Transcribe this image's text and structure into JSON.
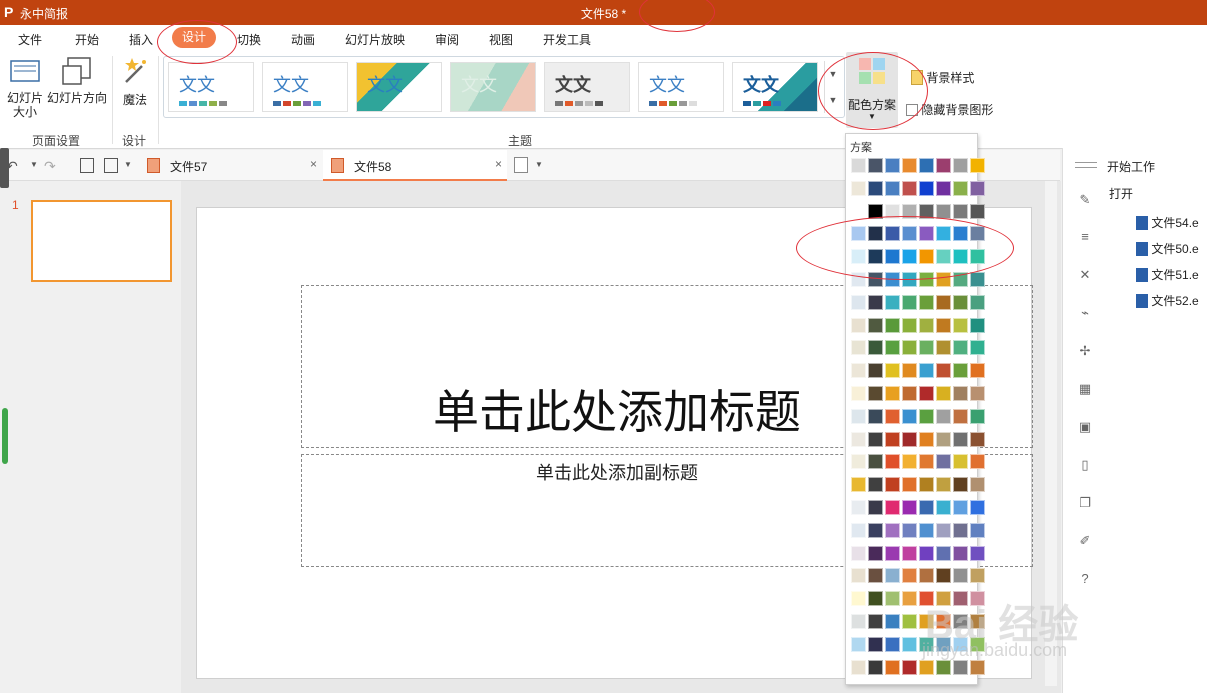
{
  "title_bar": {
    "app_name": "永中简报",
    "doc_title": "文件58 *"
  },
  "menu": [
    "文件",
    "开始",
    "插入",
    "设计",
    "切换",
    "动画",
    "幻灯片放映",
    "审阅",
    "视图",
    "开发工具"
  ],
  "ribbon": {
    "slide_size": "幻灯片\n大小",
    "slide_orientation": "幻灯片方向",
    "page_setup_group": "页面设置",
    "magic": "魔法",
    "design_group": "设计",
    "themes_group": "主题",
    "theme_text": "文文",
    "color_scheme": "配色方案",
    "bg_style": "背景样式",
    "hide_bg": "隐藏背景图形"
  },
  "tabs": [
    "文件57",
    "文件58"
  ],
  "slide_number": "1",
  "slide": {
    "title_placeholder": "单击此处添加标题",
    "subtitle_placeholder": "单击此处添加副标题"
  },
  "right_panel": {
    "start": "开始工作",
    "open": "打开",
    "files": [
      "文件54.e",
      "文件50.e",
      "文件51.e",
      "文件52.e"
    ]
  },
  "dropdown": {
    "header": "方案"
  },
  "watermark": {
    "text": "Bai 经验",
    "url": "jingyan.baidu.com"
  }
}
